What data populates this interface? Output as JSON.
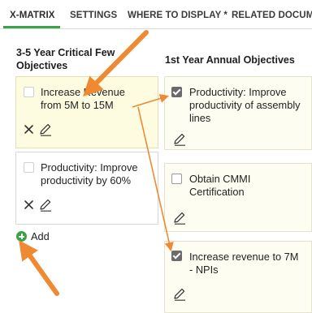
{
  "tabs": [
    {
      "label": "X-MATRIX",
      "active": true
    },
    {
      "label": "SETTINGS",
      "active": false
    },
    {
      "label": "WHERE TO DISPLAY *",
      "active": false
    },
    {
      "label": "RELATED DOCUMENTS",
      "active": false
    }
  ],
  "left_column": {
    "heading": "3-5 Year Critical Few Objectives",
    "cards": [
      {
        "label": "Increase Revenue from 5M to 15M",
        "checked": false,
        "highlighted": true
      },
      {
        "label": "Productivity: Improve productivity by 60%",
        "checked": false,
        "highlighted": false
      }
    ],
    "add_label": "Add"
  },
  "right_column": {
    "heading": "1st Year Annual Objectives",
    "cards": [
      {
        "label": "Productivity: Improve productivity of assembly lines",
        "checked": true
      },
      {
        "label": "Obtain CMMI Certification",
        "checked": false
      },
      {
        "label": "Increase revenue to 7M - NPIs",
        "checked": true
      }
    ]
  },
  "icons": {
    "delete": "close-icon",
    "edit": "pencil-icon",
    "add": "plus-circle-icon"
  },
  "colors": {
    "accent_green": "#3aa34a",
    "annotation_orange": "#f08a32",
    "card_yellow": "#fefce0"
  }
}
